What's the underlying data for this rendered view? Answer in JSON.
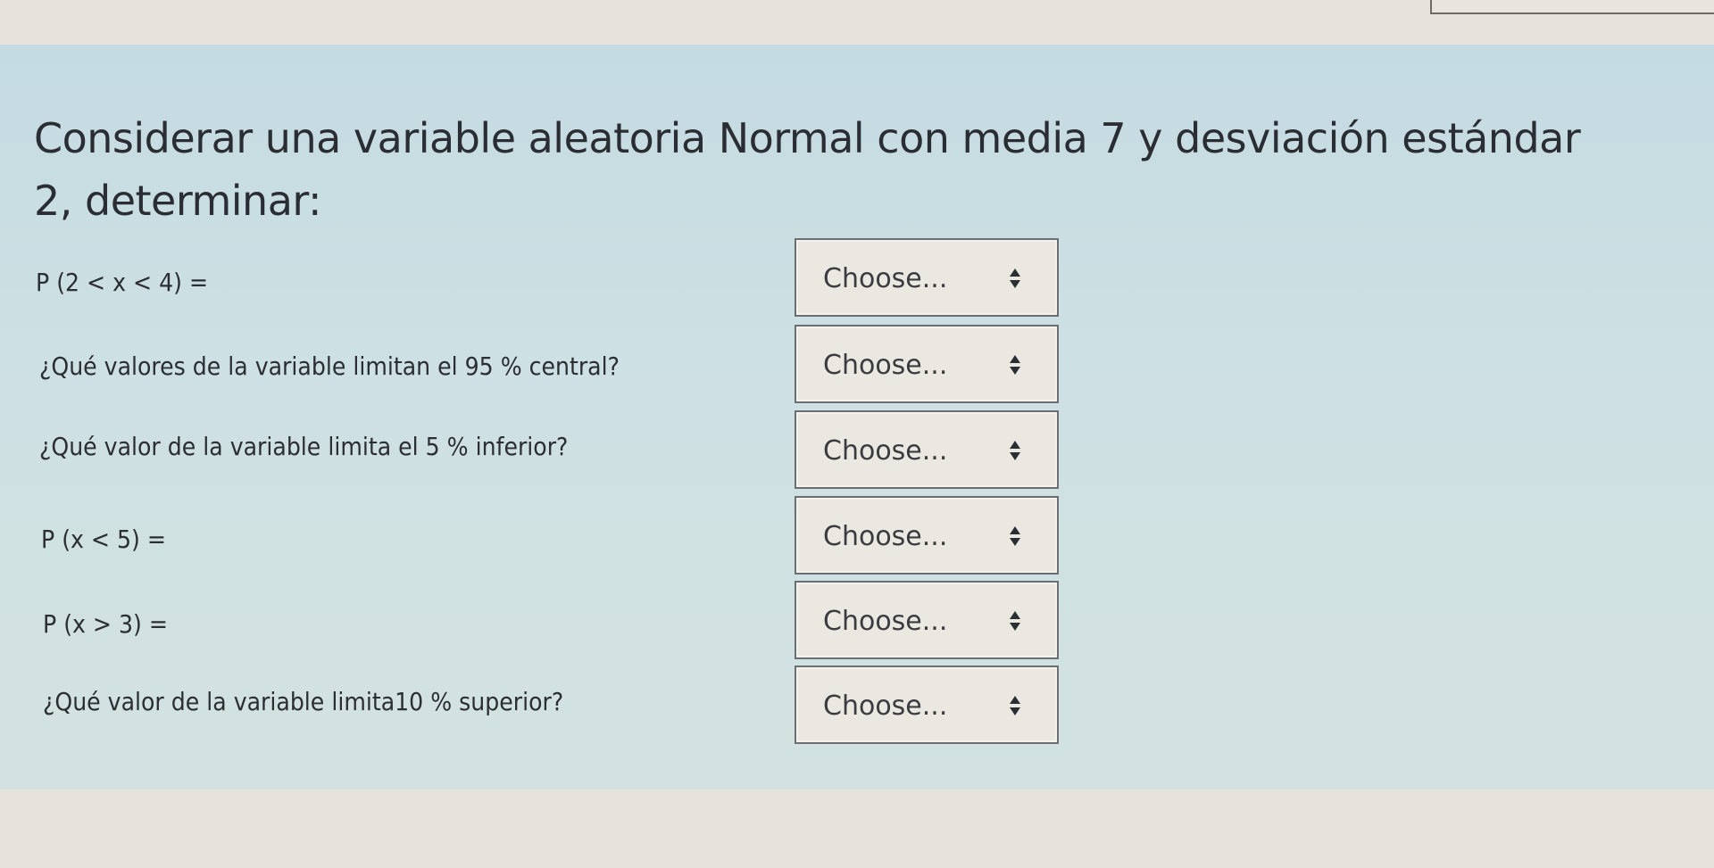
{
  "intro": {
    "line1": "Considerar una variable aleatoria Normal con media 7 y desviación estándar",
    "line2": "2, determinar:"
  },
  "questions": [
    {
      "label": "P (2 < x < 4) =",
      "select": {
        "value": "Choose...",
        "icon": "updown-arrows-icon"
      }
    },
    {
      "label": "¿Qué valores de la variable limitan el 95 % central?",
      "select": {
        "value": "Choose...",
        "icon": "updown-arrows-icon"
      }
    },
    {
      "label": "¿Qué valor de la variable limita el 5 % inferior?",
      "select": {
        "value": "Choose...",
        "icon": "updown-arrows-icon"
      }
    },
    {
      "label": "P (x < 5) =",
      "select": {
        "value": "Choose...",
        "icon": "updown-arrows-icon"
      }
    },
    {
      "label": "P (x > 3) =",
      "select": {
        "value": "Choose...",
        "icon": "updown-arrows-icon"
      }
    },
    {
      "label": "¿Qué valor de la variable limita10 % superior?",
      "select": {
        "value": "Choose...",
        "icon": "updown-arrows-icon"
      }
    }
  ],
  "colors": {
    "panel": "#c9dde2",
    "page": "#e6e3dc",
    "select_bg": "#ebe8e1",
    "select_border": "#6b6f72",
    "text": "#2a2d33"
  }
}
